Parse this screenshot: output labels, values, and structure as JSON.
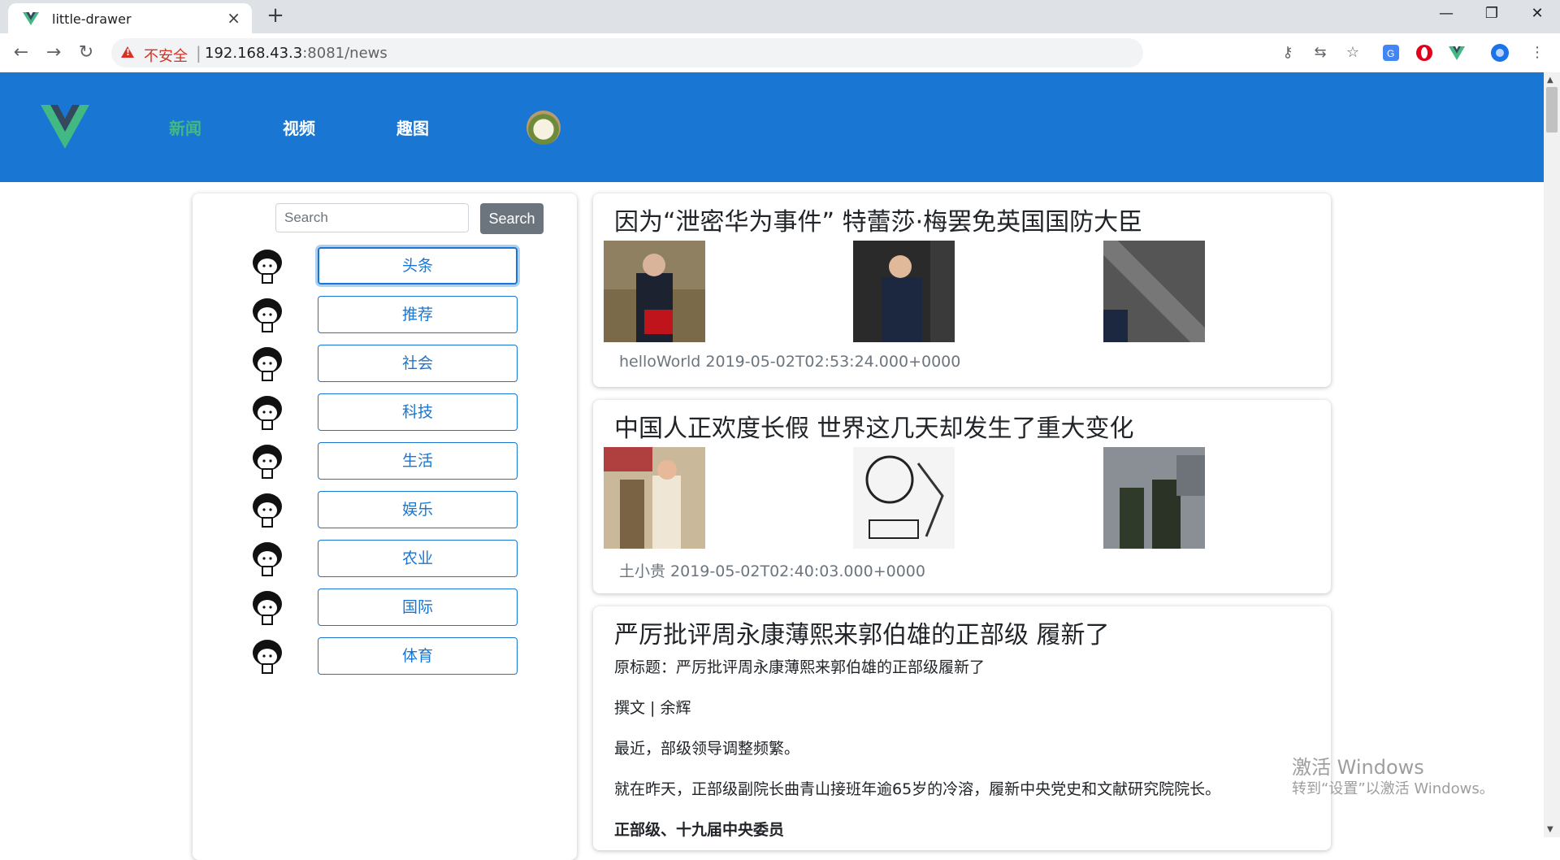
{
  "browser": {
    "tab_title": "little-drawer",
    "tab_close": "×",
    "new_tab": "+",
    "insecure_label": "不安全",
    "separator": "|",
    "url_host": "192.168.43.3",
    "url_path": ":8081/news",
    "minimize": "—",
    "maximize": "❐",
    "close": "✕",
    "back": "←",
    "forward": "→",
    "reload": "↻",
    "key": "⚷",
    "translate": "⇆",
    "star": "☆",
    "menu": "⋮"
  },
  "header": {
    "nav": [
      "新闻",
      "视频",
      "趣图"
    ],
    "brand_color": "#1976d2",
    "active_color": "#42b983"
  },
  "sidebar": {
    "search_placeholder": "Search",
    "search_button": "Search",
    "categories": [
      "头条",
      "推荐",
      "社会",
      "科技",
      "生活",
      "娱乐",
      "农业",
      "国际",
      "体育"
    ]
  },
  "news": [
    {
      "title": "因为“泄密华为事件” 特蕾莎·梅罢免英国国防大臣",
      "meta": "helloWorld 2019-05-02T02:53:24.000+0000"
    },
    {
      "title": "中国人正欢度长假 世界这几天却发生了重大变化",
      "meta": "土小贵 2019-05-02T02:40:03.000+0000"
    },
    {
      "title": "严厉批评周永康薄熙来郭伯雄的正部级 履新了",
      "lines": [
        "原标题：严厉批评周永康薄熙来郭伯雄的正部级履新了",
        "撰文 | 余辉",
        "最近，部级领导调整频繁。",
        "就在昨天，正部级副院长曲青山接班年逾65岁的冷溶，履新中央党史和文献研究院院长。",
        "正部级、十九届中央委员"
      ]
    }
  ],
  "watermark": {
    "line1": "激活 Windows",
    "line2": "转到“设置”以激活 Windows。"
  }
}
